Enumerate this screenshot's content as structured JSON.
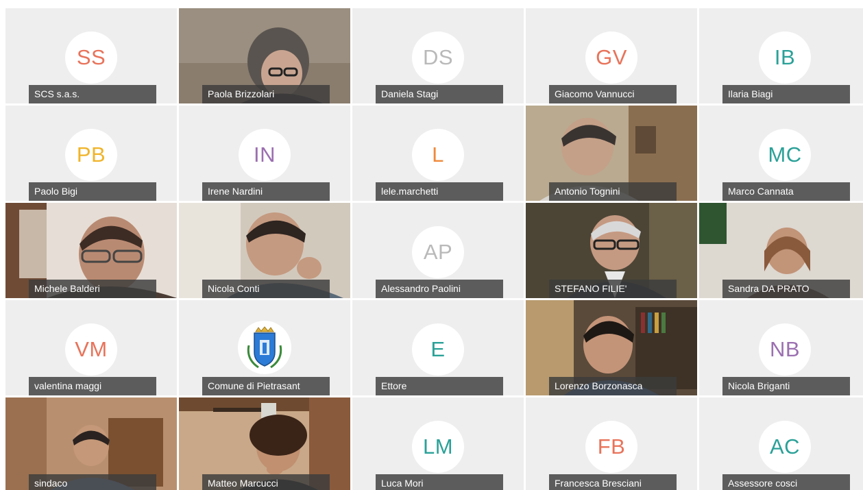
{
  "participants": [
    {
      "name": "SCS s.a.s.",
      "initials": "SS",
      "color": "#e8735a",
      "type": "avatar"
    },
    {
      "name": "Paola Brizzolari",
      "type": "video"
    },
    {
      "name": "Daniela Stagi",
      "initials": "DS",
      "color": "#b9b9b9",
      "type": "avatar"
    },
    {
      "name": "Giacomo Vannucci",
      "initials": "GV",
      "color": "#e8735a",
      "type": "avatar"
    },
    {
      "name": "Ilaria Biagi",
      "initials": "IB",
      "color": "#2aa198",
      "type": "avatar"
    },
    {
      "name": "Paolo Bigi",
      "initials": "PB",
      "color": "#f0b429",
      "type": "avatar"
    },
    {
      "name": "Irene Nardini",
      "initials": "IN",
      "color": "#9b6fb0",
      "type": "avatar"
    },
    {
      "name": "lele.marchetti",
      "initials": "L",
      "color": "#ef8a3c",
      "type": "avatar"
    },
    {
      "name": "Antonio Tognini",
      "type": "video"
    },
    {
      "name": "Marco Cannata",
      "initials": "MC",
      "color": "#2aa198",
      "type": "avatar"
    },
    {
      "name": "Michele Balderi",
      "type": "video"
    },
    {
      "name": "Nicola Conti",
      "type": "video"
    },
    {
      "name": "Alessandro Paolini",
      "initials": "AP",
      "color": "#b9b9b9",
      "type": "avatar"
    },
    {
      "name": "STEFANO FILIE'",
      "type": "video"
    },
    {
      "name": "Sandra DA PRATO",
      "type": "video"
    },
    {
      "name": "valentina maggi",
      "initials": "VM",
      "color": "#e8735a",
      "type": "avatar"
    },
    {
      "name": "Comune di Pietrasant",
      "type": "logo"
    },
    {
      "name": "Ettore",
      "initials": "E",
      "color": "#2aa198",
      "type": "avatar"
    },
    {
      "name": "Lorenzo Borzonasca",
      "type": "video"
    },
    {
      "name": "Nicola Briganti",
      "initials": "NB",
      "color": "#9b6fb0",
      "type": "avatar"
    },
    {
      "name": "sindaco",
      "type": "video"
    },
    {
      "name": "Matteo Marcucci",
      "type": "video"
    },
    {
      "name": "Luca Mori",
      "initials": "LM",
      "color": "#2aa198",
      "type": "avatar"
    },
    {
      "name": "Francesca Bresciani",
      "initials": "FB",
      "color": "#e8735a",
      "type": "avatar"
    },
    {
      "name": "Assessore cosci",
      "initials": "AC",
      "color": "#2aa198",
      "type": "avatar"
    }
  ]
}
